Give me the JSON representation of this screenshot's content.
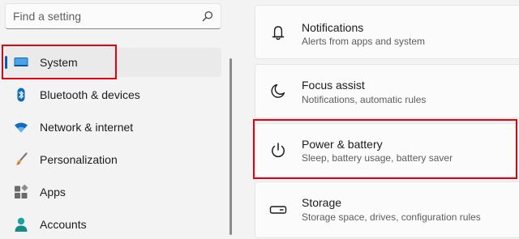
{
  "search": {
    "placeholder": "Find a setting",
    "icon": "search-icon"
  },
  "sidebar": {
    "items": [
      {
        "label": "System",
        "icon": "system-display-icon",
        "selected": true
      },
      {
        "label": "Bluetooth & devices",
        "icon": "bluetooth-icon"
      },
      {
        "label": "Network & internet",
        "icon": "wifi-icon"
      },
      {
        "label": "Personalization",
        "icon": "paintbrush-icon"
      },
      {
        "label": "Apps",
        "icon": "apps-icon"
      },
      {
        "label": "Accounts",
        "icon": "person-icon"
      }
    ]
  },
  "settings": {
    "cards": [
      {
        "title": "Notifications",
        "subtitle": "Alerts from apps and system",
        "icon": "bell-icon"
      },
      {
        "title": "Focus assist",
        "subtitle": "Notifications, automatic rules",
        "icon": "moon-icon"
      },
      {
        "title": "Power & battery",
        "subtitle": "Sleep, battery usage, battery saver",
        "icon": "power-icon"
      },
      {
        "title": "Storage",
        "subtitle": "Storage space, drives, configuration rules",
        "icon": "storage-drive-icon"
      }
    ]
  },
  "colors": {
    "accent": "#005fb8",
    "highlight": "#e8000f",
    "background": "#f3f3f3",
    "card": "#fbfbfb"
  }
}
